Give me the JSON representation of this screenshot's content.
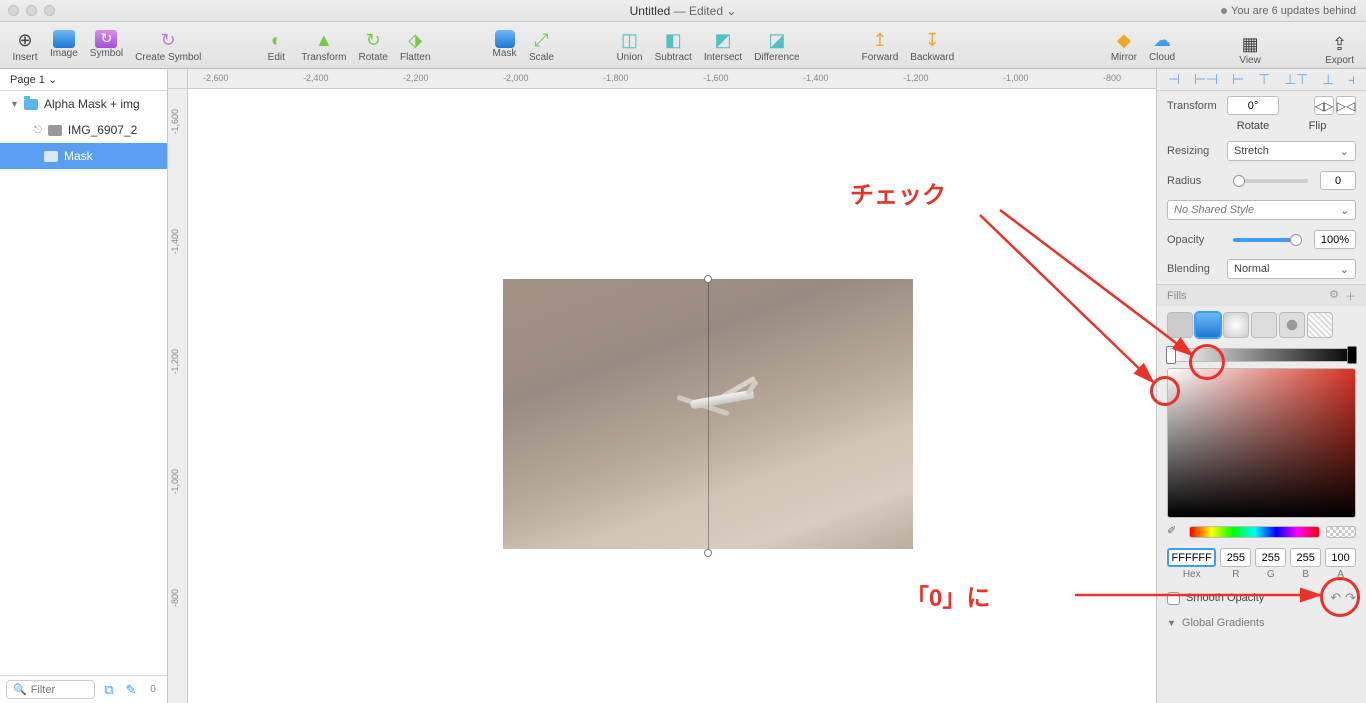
{
  "titlebar": {
    "title_main": "Untitled",
    "title_suffix": " — Edited ⌄",
    "updates": "You are 6 updates behind"
  },
  "toolbar": {
    "insert": "Insert",
    "image": "Image",
    "symbol": "Symbol",
    "create_symbol": "Create Symbol",
    "edit": "Edit",
    "transform": "Transform",
    "rotate": "Rotate",
    "flatten": "Flatten",
    "mask": "Mask",
    "scale": "Scale",
    "union": "Union",
    "subtract": "Subtract",
    "intersect": "Intersect",
    "difference": "Difference",
    "forward": "Forward",
    "backward": "Backward",
    "mirror": "Mirror",
    "cloud": "Cloud",
    "view": "View",
    "export": "Export"
  },
  "sidebar": {
    "page_label": "Page 1 ⌄",
    "items": [
      {
        "label": "Alpha Mask + img"
      },
      {
        "label": "IMG_6907_2"
      },
      {
        "label": "Mask"
      }
    ],
    "filter_placeholder": "Filter"
  },
  "ruler_h": [
    "-2,600",
    "-2,400",
    "-2,200",
    "-2,000",
    "-1,800",
    "-1,600",
    "-1,400",
    "-1,200",
    "-1,000",
    "-800"
  ],
  "ruler_v": [
    "-1,600",
    "-1,400",
    "-1,200",
    "-1,000",
    "-800"
  ],
  "inspector": {
    "transform_label": "Transform",
    "rotate_value": "0°",
    "rotate_sublabel": "Rotate",
    "flip_sublabel": "Flip",
    "resizing_label": "Resizing",
    "resizing_value": "Stretch",
    "radius_label": "Radius",
    "radius_value": "0",
    "style_label": "No Shared Style",
    "opacity_label": "Opacity",
    "opacity_value": "100%",
    "blending_label": "Blending",
    "blending_value": "Normal",
    "fills_label": "Fills",
    "hex": "FFFFFF",
    "r": "255",
    "g": "255",
    "b": "255",
    "a": "100",
    "hex_lbl": "Hex",
    "r_lbl": "R",
    "g_lbl": "G",
    "b_lbl": "B",
    "a_lbl": "A",
    "smooth_label": "Smooth Opacity",
    "global_grad": "Global Gradients"
  },
  "annotations": {
    "check": "チェック",
    "zero": "「0」に"
  }
}
